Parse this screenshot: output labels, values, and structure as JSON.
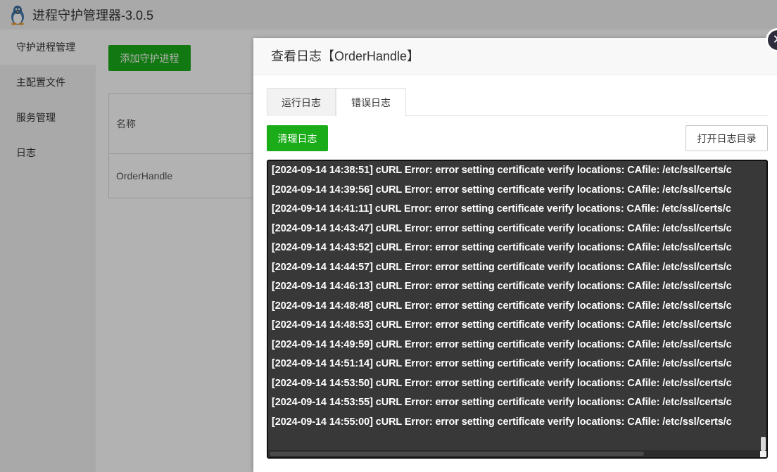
{
  "app": {
    "title": "进程守护管理器-3.0.5",
    "add_button": "添加守护进程",
    "sidebar": [
      {
        "label": "守护进程管理"
      },
      {
        "label": "主配置文件"
      },
      {
        "label": "服务管理"
      },
      {
        "label": "日志"
      }
    ],
    "table": {
      "header_name": "名称",
      "rows": [
        {
          "name": "OrderHandle"
        }
      ]
    }
  },
  "modal": {
    "title": "查看日志【OrderHandle】",
    "close_label": "✕",
    "tabs": [
      {
        "label": "运行日志",
        "active": false
      },
      {
        "label": "错误日志",
        "active": true
      }
    ],
    "clear_button": "清理日志",
    "open_dir_button": "打开日志目录",
    "log_lines": [
      "[2024-09-14 14:38:51] cURL Error: error setting certificate verify locations:  CAfile: /etc/ssl/certs/c",
      "[2024-09-14 14:39:56] cURL Error: error setting certificate verify locations:  CAfile: /etc/ssl/certs/c",
      "[2024-09-14 14:41:11] cURL Error: error setting certificate verify locations:  CAfile: /etc/ssl/certs/c",
      "[2024-09-14 14:43:47] cURL Error: error setting certificate verify locations:  CAfile: /etc/ssl/certs/c",
      "[2024-09-14 14:43:52] cURL Error: error setting certificate verify locations:  CAfile: /etc/ssl/certs/c",
      "[2024-09-14 14:44:57] cURL Error: error setting certificate verify locations:  CAfile: /etc/ssl/certs/c",
      "[2024-09-14 14:46:13] cURL Error: error setting certificate verify locations:  CAfile: /etc/ssl/certs/c",
      "[2024-09-14 14:48:48] cURL Error: error setting certificate verify locations:  CAfile: /etc/ssl/certs/c",
      "[2024-09-14 14:48:53] cURL Error: error setting certificate verify locations:  CAfile: /etc/ssl/certs/c",
      "[2024-09-14 14:49:59] cURL Error: error setting certificate verify locations:  CAfile: /etc/ssl/certs/c",
      "[2024-09-14 14:51:14] cURL Error: error setting certificate verify locations:  CAfile: /etc/ssl/certs/c",
      "[2024-09-14 14:53:50] cURL Error: error setting certificate verify locations:  CAfile: /etc/ssl/certs/c",
      "[2024-09-14 14:53:55] cURL Error: error setting certificate verify locations:  CAfile: /etc/ssl/certs/c",
      "[2024-09-14 14:55:00] cURL Error: error setting certificate verify locations:  CAfile: /etc/ssl/certs/c"
    ]
  },
  "colors": {
    "primary_green": "#1aad19",
    "log_background": "#383838",
    "close_button": "#2e2d3c"
  },
  "icons": {
    "logo": "penguin-icon",
    "close": "close-icon"
  }
}
